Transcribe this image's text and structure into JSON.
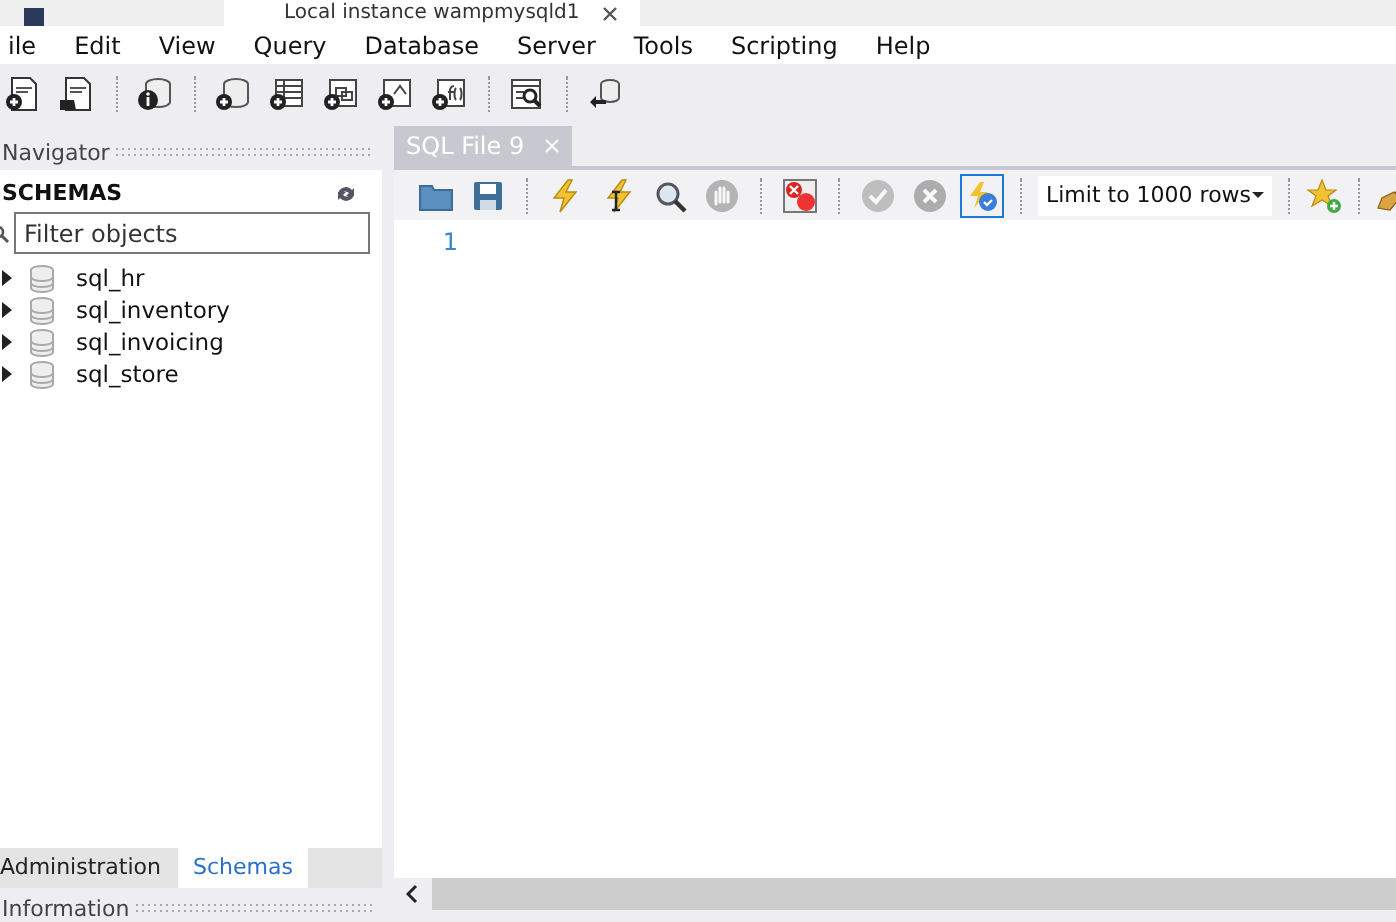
{
  "window": {
    "title": "Local instance wampmysqld1"
  },
  "menu": [
    "ile",
    "Edit",
    "View",
    "Query",
    "Database",
    "Server",
    "Tools",
    "Scripting",
    "Help"
  ],
  "navigator": {
    "title": "Navigator",
    "section": "SCHEMAS",
    "filter": {
      "placeholder": "Filter objects"
    },
    "schemas": [
      {
        "name": "sql_hr",
        "expanded": false
      },
      {
        "name": "sql_inventory",
        "expanded": false
      },
      {
        "name": "sql_invoicing",
        "expanded": false
      },
      {
        "name": "sql_store",
        "expanded": false
      }
    ],
    "tabs": [
      {
        "label": "Administration",
        "selected": false
      },
      {
        "label": "Schemas",
        "selected": true
      }
    ],
    "info_title": "Information"
  },
  "editor": {
    "tab": "SQL File 9",
    "toolbar": [
      {
        "disabled": false,
        "on": false
      },
      {
        "disabled": false,
        "on": false
      },
      {
        "disabled": false,
        "on": false
      },
      {
        "disabled": false,
        "on": false
      },
      {
        "disabled": false,
        "on": false
      },
      {
        "disabled": true,
        "on": false
      },
      {
        "disabled": false,
        "on": false
      },
      {
        "disabled": true,
        "on": false
      },
      {
        "disabled": true,
        "on": false
      },
      {
        "disabled": false,
        "on": true
      }
    ],
    "limit": "Limit to 1000 rows",
    "line_numbers": [
      "1"
    ]
  }
}
